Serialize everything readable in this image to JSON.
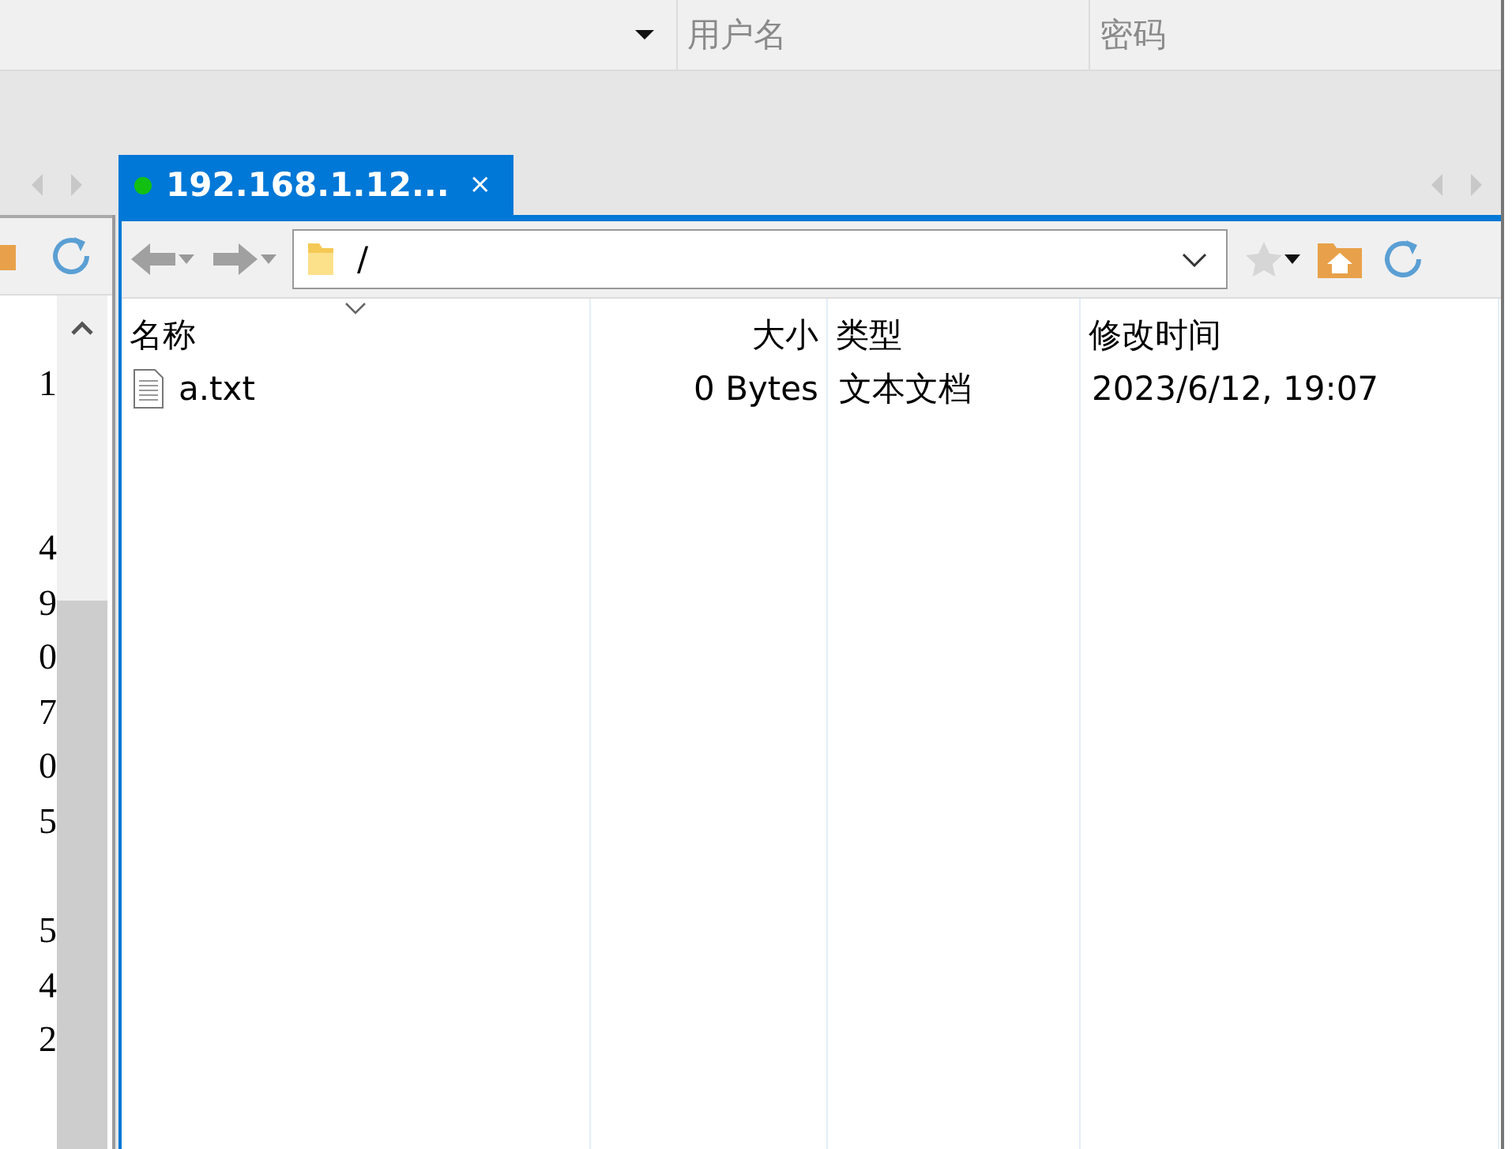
{
  "connection_bar": {
    "username": {
      "placeholder": "用户名"
    },
    "password": {
      "placeholder": "密码"
    }
  },
  "tabs": [
    {
      "label": "192.168.1.12...",
      "selected": true,
      "connected": true,
      "close": "×"
    }
  ],
  "left_panel": {
    "rows": [
      {
        "text": "1"
      },
      {},
      {},
      {
        "text": "4"
      },
      {
        "text": "9"
      },
      {
        "text": "0"
      },
      {
        "text": "7"
      },
      {
        "text": "0"
      },
      {
        "text": "5"
      },
      {},
      {
        "text": "5"
      },
      {
        "text": "4"
      },
      {
        "text": "2"
      }
    ]
  },
  "remote_panel": {
    "path": "/",
    "columns": [
      {
        "label": "名称",
        "sorted": true,
        "kind": "text"
      },
      {
        "label": "大小",
        "sorted": false,
        "kind": "number"
      },
      {
        "label": "类型",
        "sorted": false,
        "kind": "text"
      },
      {
        "label": "修改时间",
        "sorted": false,
        "kind": "text"
      }
    ],
    "rows": [
      {
        "name": "a.txt",
        "size": "0 Bytes",
        "type": "文本文档",
        "modified": "2023/6/12, 19:07"
      }
    ]
  }
}
